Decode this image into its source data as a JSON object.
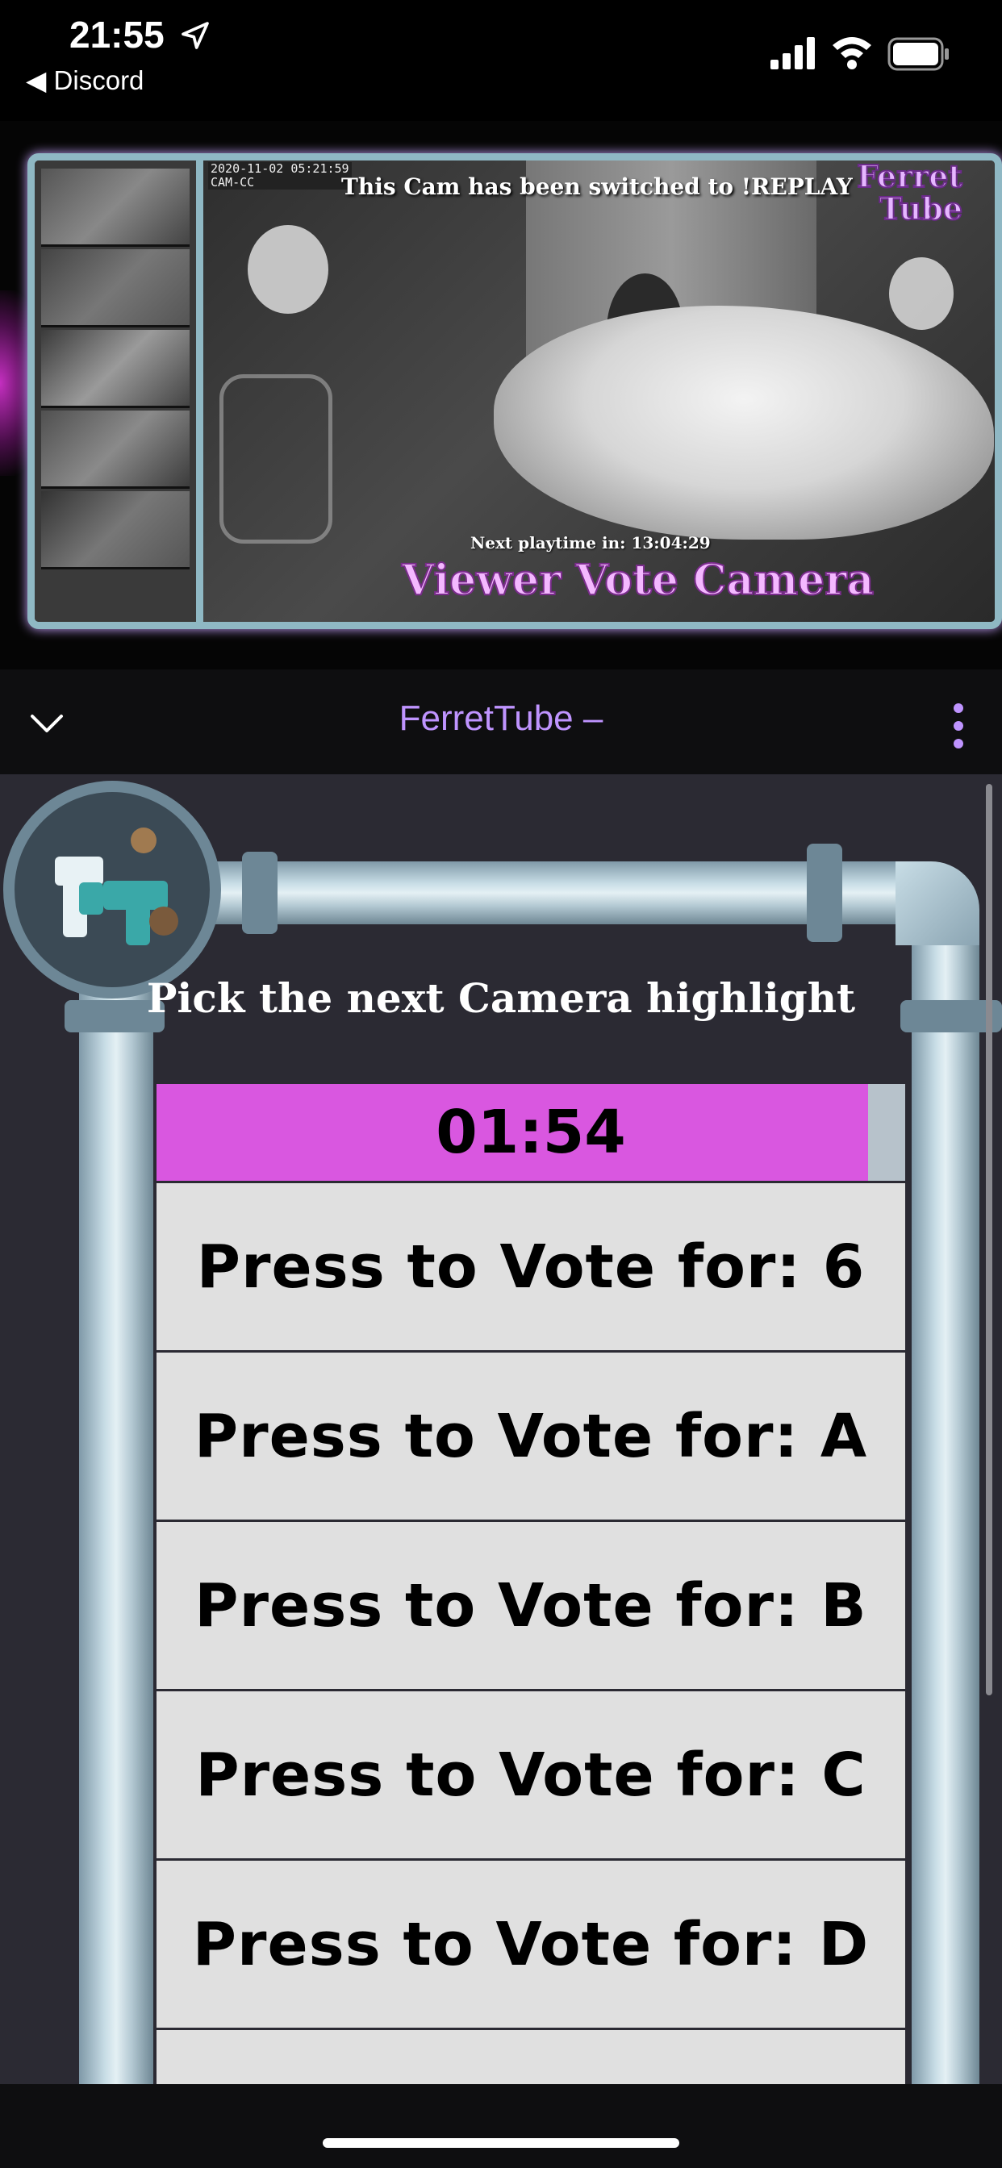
{
  "status_bar": {
    "time": "21:55",
    "back_label": "◀ Discord"
  },
  "video": {
    "timestamp": "2020-11-02 05:21:59",
    "cam_label": "CAM-CC",
    "overlay_message": "This Cam has been switched to !REPLAY",
    "logo_line1": "Ferret",
    "logo_line2": "Tube",
    "next_playtime": "Next playtime in: 13:04:29",
    "banner": "Viewer Vote Camera"
  },
  "header": {
    "title": "FerretTube –"
  },
  "extension": {
    "heading": "Pick the next Camera highlight",
    "timer": "01:54",
    "timer_progress": 0.95,
    "vote_options": [
      "Press to Vote for: 6",
      "Press to Vote for: A",
      "Press to Vote for: B",
      "Press to Vote for: C",
      "Press to Vote for: D"
    ]
  },
  "colors": {
    "accent_purple": "#bf94ff",
    "timer_fill": "#d957e0",
    "panel_bg": "#2b2a33"
  }
}
